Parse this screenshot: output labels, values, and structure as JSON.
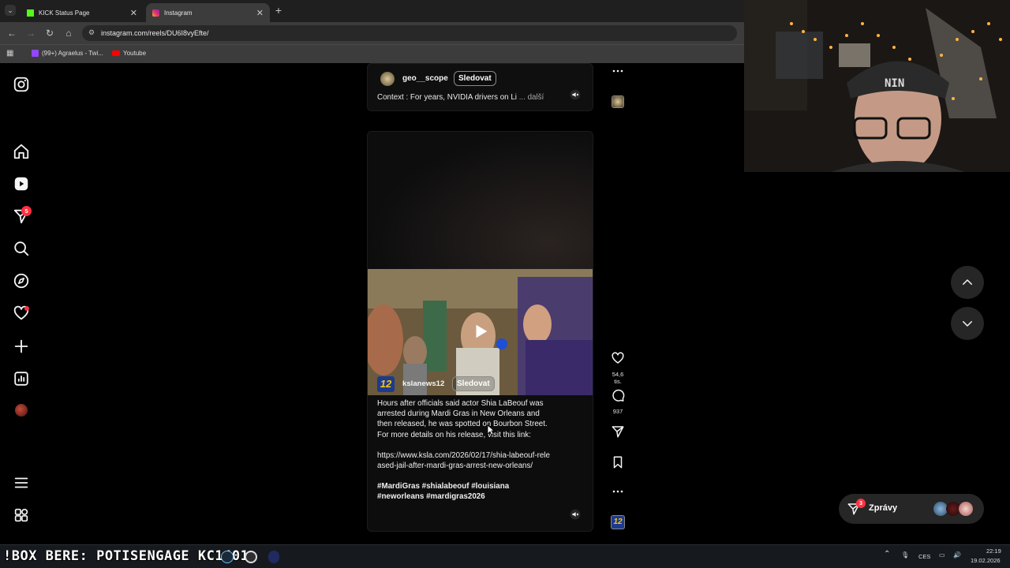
{
  "browser": {
    "tabs": [
      {
        "label": "KICK Status Page",
        "icon": "kick-logo-icon"
      },
      {
        "label": "Instagram",
        "icon": "instagram-logo-icon"
      }
    ],
    "new_tab": "+",
    "url": "instagram.com/reels/DU6I8vyEfte/",
    "bookmarks": [
      {
        "label": "(99+) Agraelus - Twi...",
        "icon": "twitch-icon"
      },
      {
        "label": "Youtube",
        "icon": "youtube-icon"
      }
    ]
  },
  "sidebar": {
    "items": [
      {
        "name": "instagram-logo-icon"
      },
      {
        "name": "home-icon"
      },
      {
        "name": "reels-icon"
      },
      {
        "name": "direct-icon",
        "badge": "5"
      },
      {
        "name": "search-icon"
      },
      {
        "name": "explore-icon"
      },
      {
        "name": "notifications-icon"
      },
      {
        "name": "create-icon"
      },
      {
        "name": "dashboard-icon"
      },
      {
        "name": "profile-avatar"
      },
      {
        "name": "menu-icon"
      },
      {
        "name": "also-from-meta-icon"
      }
    ]
  },
  "reel_prev": {
    "username": "geo__scope",
    "follow": "Sledovat",
    "caption": "Context : For years, NVIDIA drivers on Li",
    "more": "... další"
  },
  "reel_current": {
    "username": "kslanews12",
    "follow": "Sledovat",
    "caption_p1": "Hours after officials said actor Shia LaBeouf was arrested during Mardi Gras in New Orleans and then released, he was spotted on Bourbon Street. For more details on his release, visit this link:",
    "caption_link": "https://www.ksla.com/2026/02/17/shia-labeouf-released-jail-after-mardi-gras-arrest-new-orleans/",
    "hashtags": "#MardiGras #shialabeouf #louisiana #neworleans #mardigras2026",
    "likes": "54,6 tis.",
    "comments": "937",
    "video_logo": "12"
  },
  "messages": {
    "label": "Zprávy",
    "badge": "3"
  },
  "taskbar": {
    "overlay_text": "!BOX BERE: POTISENGAGE  KC1401",
    "lang": "CES",
    "time": "22:19",
    "date": "19.02.2026"
  },
  "colors": {
    "accent_red": "#ff3040",
    "instagram_pink": "#e1306c",
    "kick_green": "#53fc18",
    "card_bg": "#0f0f10"
  }
}
